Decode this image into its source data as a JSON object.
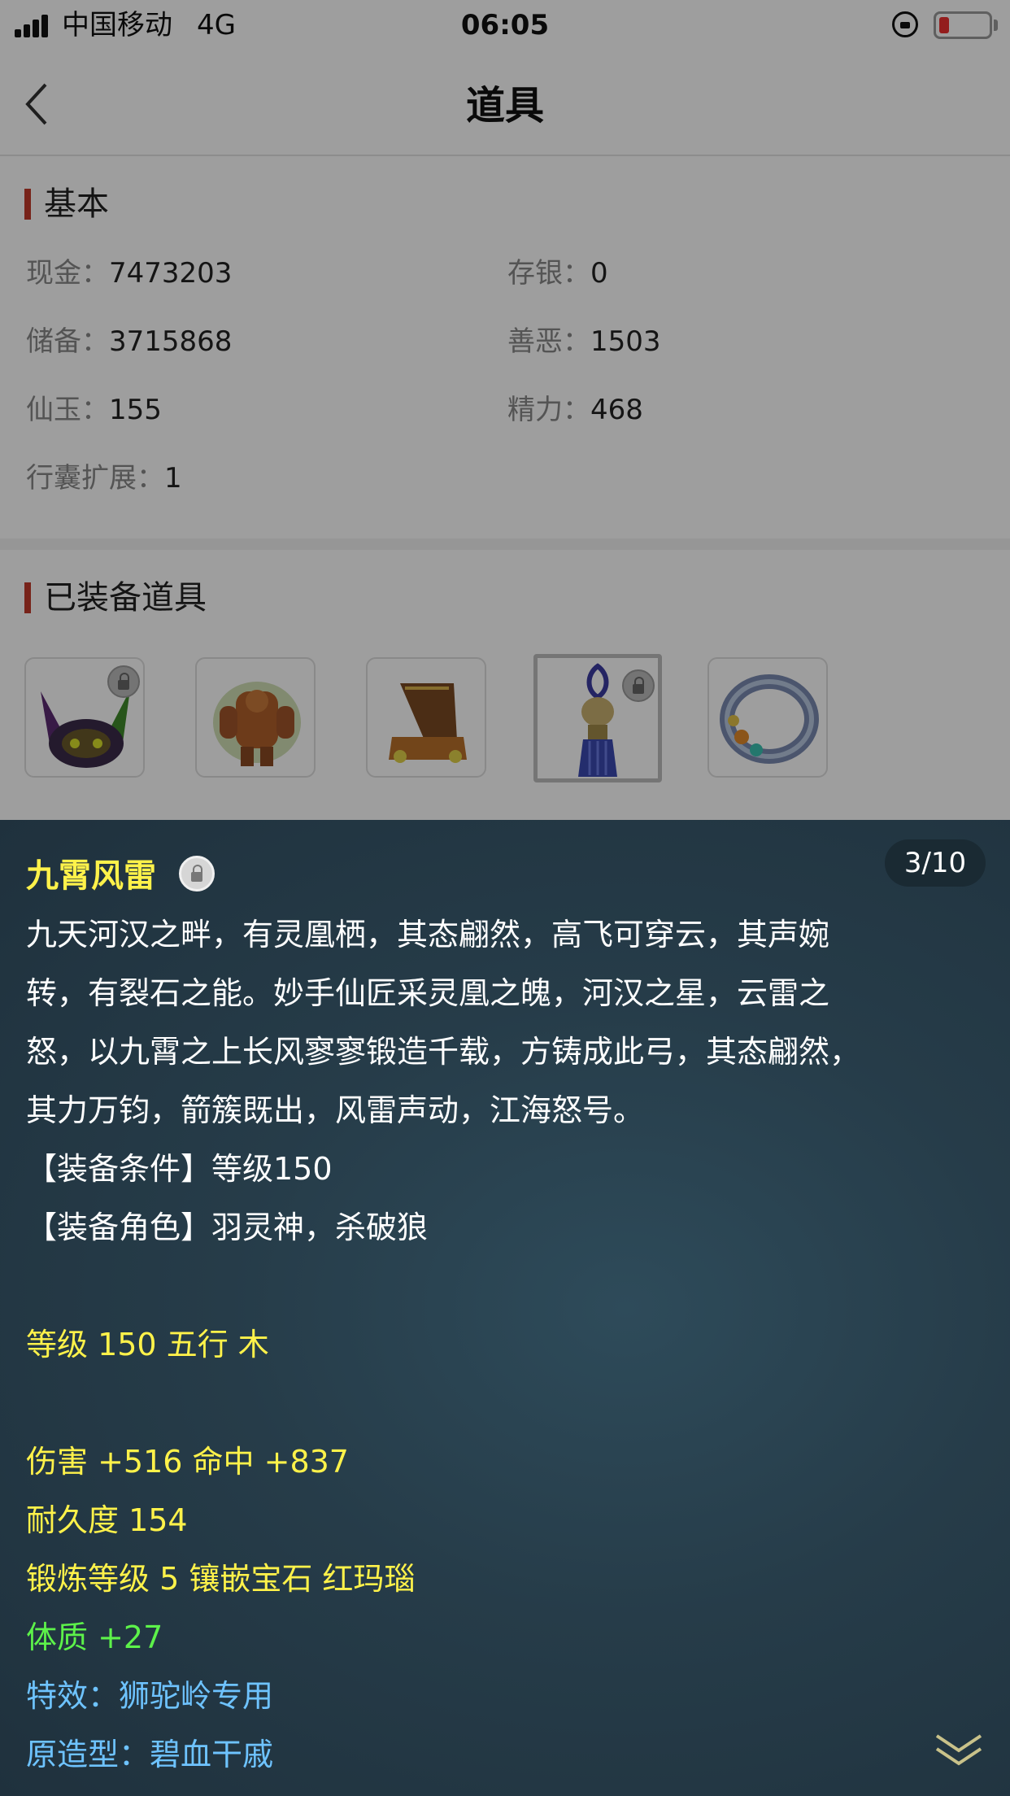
{
  "status_bar": {
    "carrier": "中国移动",
    "network": "4G",
    "time": "06:05"
  },
  "nav": {
    "title": "道具"
  },
  "basic": {
    "title": "基本",
    "fields": [
      {
        "label": "现金：",
        "value": "7473203"
      },
      {
        "label": "存银：",
        "value": "0"
      },
      {
        "label": "储备：",
        "value": "3715868"
      },
      {
        "label": "善恶：",
        "value": "1503"
      },
      {
        "label": "仙玉：",
        "value": "155"
      },
      {
        "label": "精力：",
        "value": "468"
      },
      {
        "label": "行囊扩展：",
        "value": "1"
      }
    ]
  },
  "equipped": {
    "title": "已装备道具"
  },
  "popup": {
    "page_indicator": "3/10",
    "name": "九霄风雷",
    "description_lines": [
      "九天河汉之畔，有灵凰栖，其态翩然，高飞可穿云，其声婉",
      "转，有裂石之能。妙手仙匠采灵凰之魄，河汉之星，云雷之",
      "怒，以九霄之上长风寥寥锻造千载，方铸成此弓，其态翩然，",
      "其力万钧，箭簇既出，风雷声动，江海怒号。"
    ],
    "requirement": "【装备条件】等级150",
    "roles": "【装备角色】羽灵神，杀破狼",
    "level_element": "等级 150 五行 木",
    "damage_hit": "伤害 +516 命中 +837",
    "durability": "耐久度 154",
    "forge_gem": "锻炼等级 5 镶嵌宝石 红玛瑙",
    "constitution": "体质 +27",
    "special_effect": "特效：狮驼岭专用",
    "prototype": "原造型：碧血干戚"
  },
  "colors": {
    "accent_red": "#c0392b",
    "popup_bg": "#263c49",
    "yellow_text": "#fff24a",
    "green_text": "#5df24a",
    "blue_text": "#6ec3ff"
  }
}
